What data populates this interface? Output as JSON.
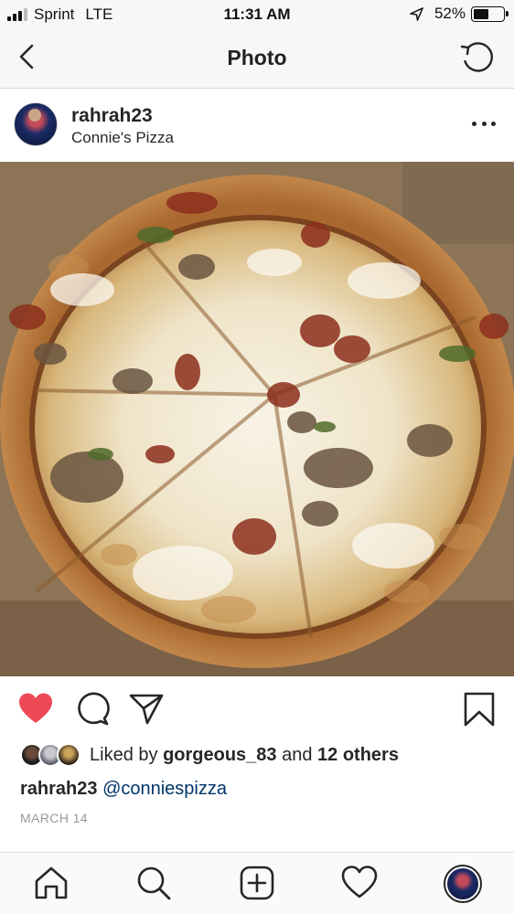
{
  "status_bar": {
    "carrier": "Sprint",
    "network": "LTE",
    "time": "11:31 AM",
    "battery_percent": "52%",
    "battery_level": 0.52
  },
  "nav": {
    "title": "Photo",
    "back_icon": "chevron-left-icon",
    "refresh_icon": "refresh-icon"
  },
  "post": {
    "username": "rahrah23",
    "location": "Connie's Pizza",
    "photo_icon": "pizza-photo"
  },
  "likes": {
    "prefix": "Liked by ",
    "top_liker": "gorgeous_83",
    "middle": " and ",
    "others": "12 others"
  },
  "caption": {
    "username": "rahrah23",
    "mention": "@conniespizza"
  },
  "date": "MARCH 14",
  "colors": {
    "like_red": "#ed4956",
    "text": "#262626",
    "mention_blue": "#003569"
  }
}
